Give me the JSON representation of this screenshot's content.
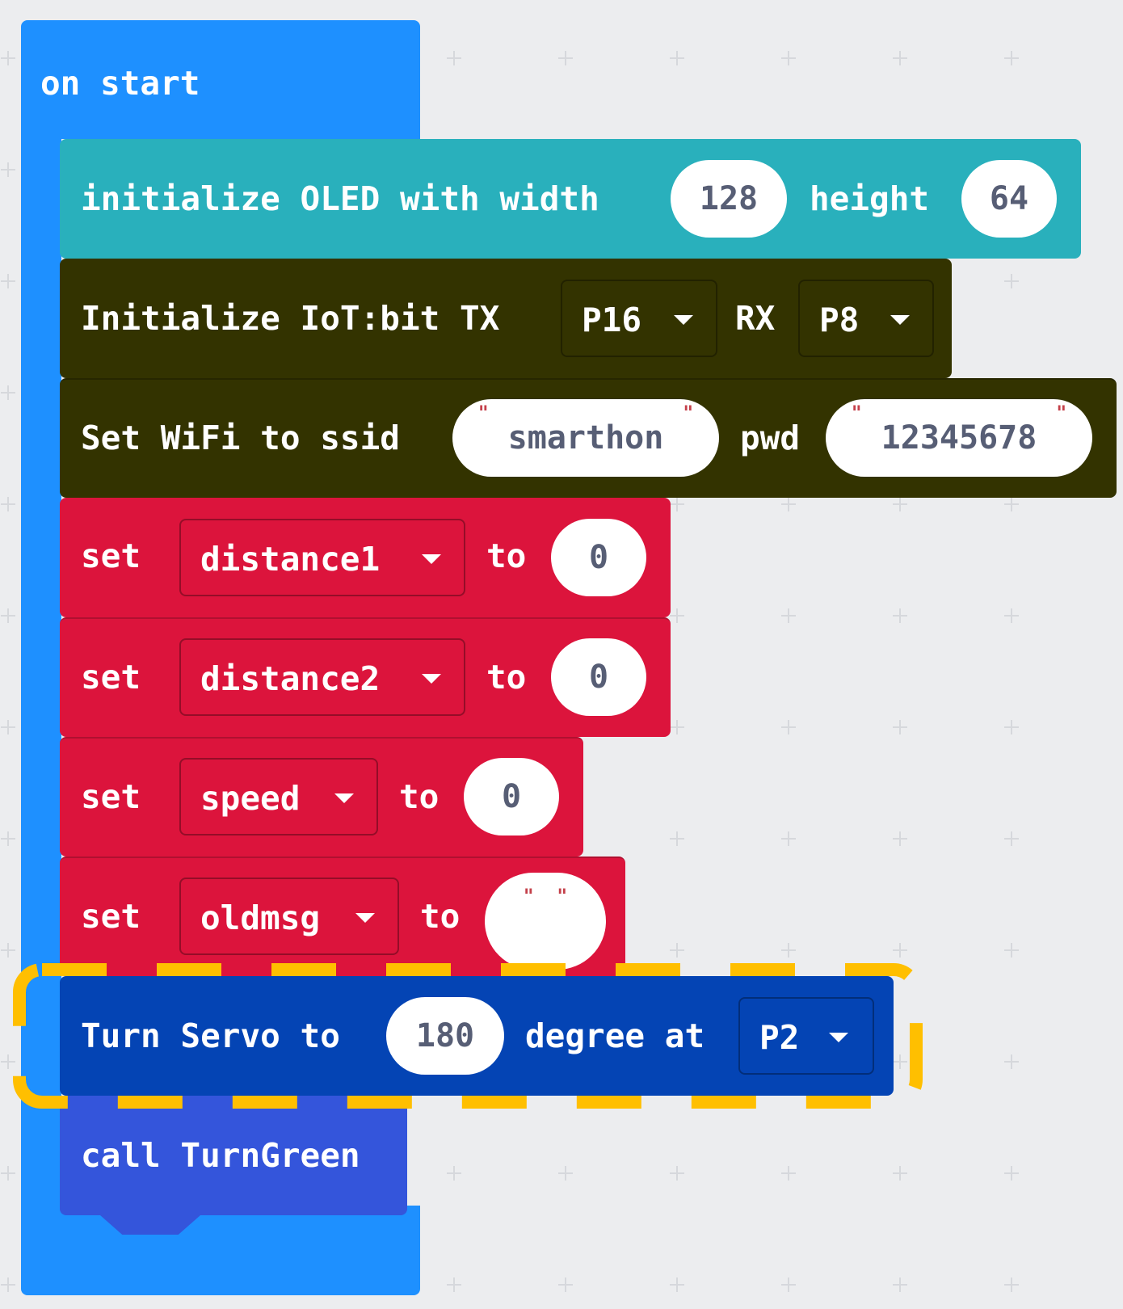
{
  "colors": {
    "workspace": "#ecedef",
    "grid_plus": "#d6d8dc",
    "events": "#1e90ff",
    "oled": "#29b0bc",
    "iot": "#333300",
    "variables": "#dc143c",
    "servo": "#0444b4",
    "functions": "#3455db",
    "highlight": "#ffbf00"
  },
  "on_start": {
    "label": "on start"
  },
  "oled": {
    "label_init": "initialize OLED with width",
    "width": "128",
    "label_height": "height",
    "height": "64"
  },
  "iot": {
    "label_init": "Initialize IoT:bit TX",
    "tx": "P16",
    "label_rx": "RX",
    "rx": "P8"
  },
  "wifi": {
    "label_set": "Set WiFi to ssid",
    "ssid": "smarthon",
    "label_pwd": "pwd",
    "pwd": "12345678"
  },
  "variables": [
    {
      "set": "set",
      "name": "distance1",
      "to": "to",
      "value": "0"
    },
    {
      "set": "set",
      "name": "distance2",
      "to": "to",
      "value": "0"
    },
    {
      "set": "set",
      "name": "speed",
      "to": "to",
      "value": "0"
    },
    {
      "set": "set",
      "name": "oldmsg",
      "to": "to",
      "value": ""
    }
  ],
  "servo": {
    "label_turn": "Turn Servo to",
    "angle": "180",
    "label_degree": "degree at",
    "pin": "P2"
  },
  "call": {
    "label": "call TurnGreen"
  }
}
